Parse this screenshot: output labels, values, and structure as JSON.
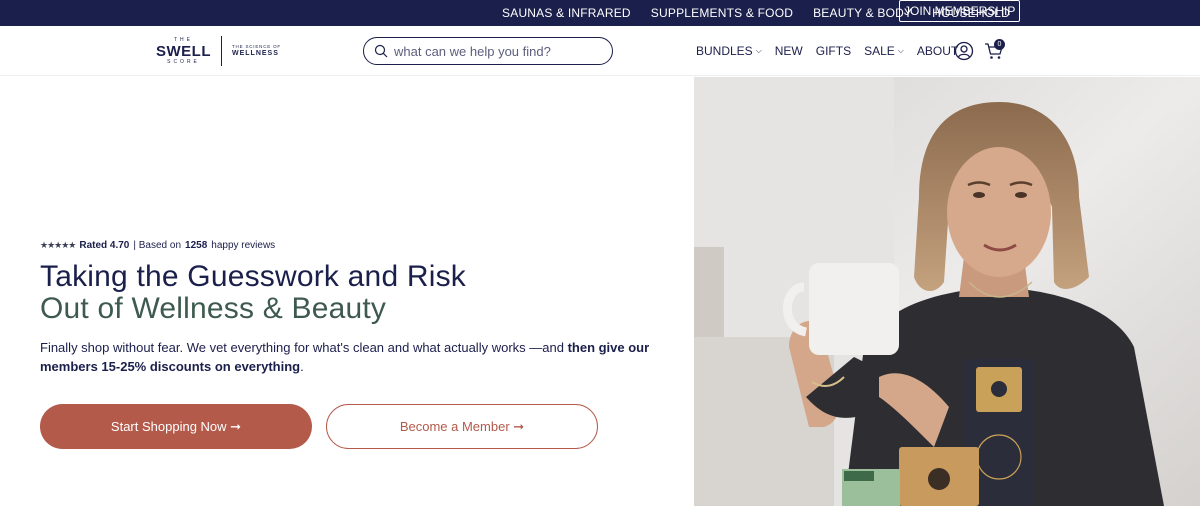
{
  "topbar": {
    "links": [
      "SAUNAS & INFRARED",
      "SUPPLEMENTS & FOOD",
      "BEAUTY & BODY",
      "HOUSEHOLD"
    ],
    "join_label": "JOIN MEMBERSHIP"
  },
  "logo": {
    "the": "THE",
    "swell": "SWELL",
    "score": "SCORE",
    "tag_small": "THE SCIENCE OF",
    "tag_big": "WELLNESS"
  },
  "search": {
    "placeholder": "what can we help you find?",
    "icon": "search-icon"
  },
  "nav": {
    "bundles": "BUNDLES",
    "new": "NEW",
    "gifts": "GIFTS",
    "sale": "SALE",
    "about": "ABOUT",
    "account_icon": "user-icon",
    "cart_icon": "cart-icon",
    "cart_count": "0"
  },
  "hero": {
    "stars": "★★★★★",
    "rated_label": "Rated 4.70",
    "based_on": "| Based on",
    "review_count": "1258",
    "reviews_suffix": "happy reviews",
    "title_line1": "Taking the Guesswork and Risk",
    "title_line2": "Out of Wellness & Beauty",
    "desc_plain": "Finally shop without fear. We vet everything for what's clean and what actually works —and ",
    "desc_bold": "then give our members 15-25% discounts on everything",
    "desc_end": ".",
    "primary_button": "Start Shopping Now ➞",
    "secondary_button": "Become a Member ➞"
  },
  "colors": {
    "navy": "#1b1f4b",
    "accent": "#b35a4a",
    "green": "#3e5a4f"
  }
}
